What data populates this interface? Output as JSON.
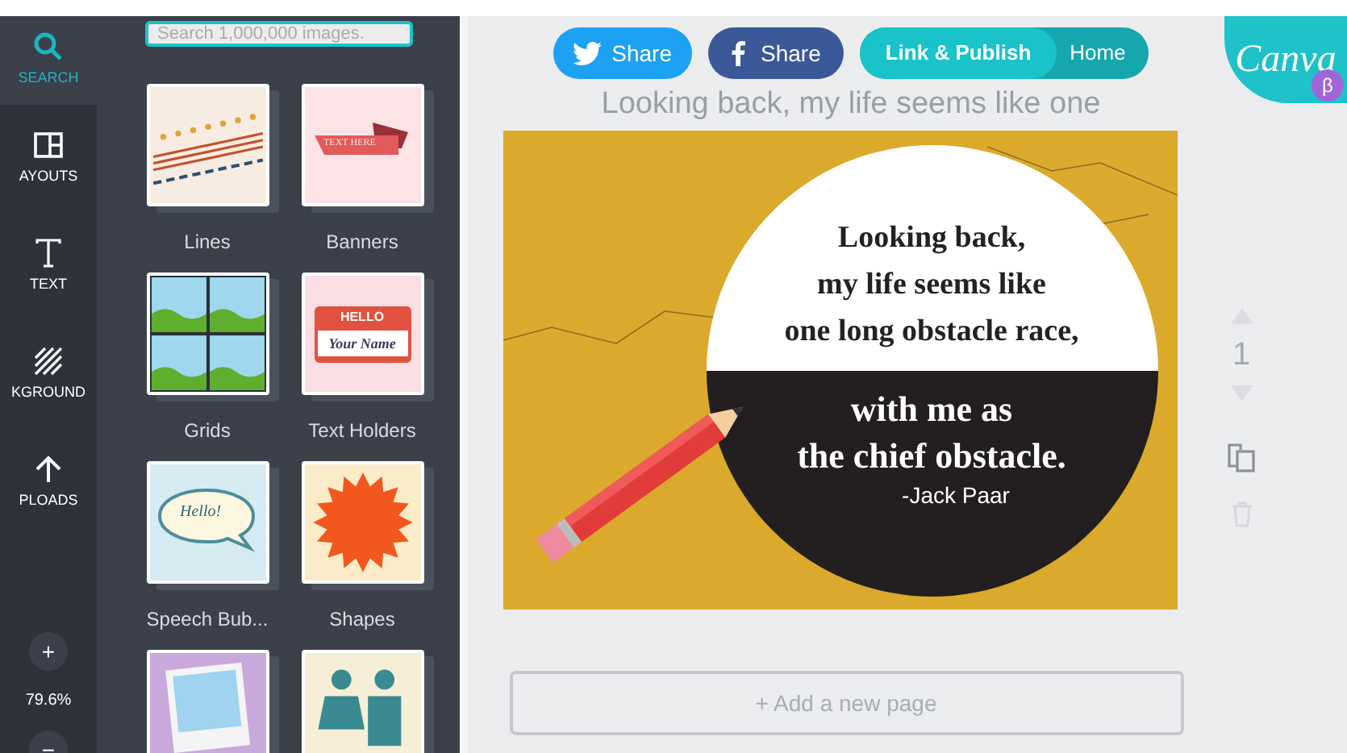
{
  "nav": {
    "items": [
      {
        "label": "SEARCH",
        "kind": "search",
        "selected": true
      },
      {
        "label": "AYOUTS",
        "kind": "layouts",
        "selected": false
      },
      {
        "label": "TEXT",
        "kind": "text",
        "selected": false
      },
      {
        "label": "KGROUND",
        "kind": "background",
        "selected": false
      },
      {
        "label": "PLOADS",
        "kind": "uploads",
        "selected": false
      }
    ],
    "zoom_in": "+",
    "zoom_level": "79.6%",
    "zoom_out": "−"
  },
  "panel": {
    "search": {
      "placeholder": "Search 1,000,000 images."
    },
    "categories": [
      {
        "label": "Lines",
        "kind": "lines"
      },
      {
        "label": "Banners",
        "kind": "banner",
        "banner_text": "TEXT HERE"
      },
      {
        "label": "Grids",
        "kind": "grid"
      },
      {
        "label": "Text Holders",
        "kind": "nametag",
        "tag_title": "HELLO",
        "tag_name": "Your Name"
      },
      {
        "label": "Speech Bub...",
        "kind": "bubble",
        "bubble_text": "Hello!"
      },
      {
        "label": "Shapes",
        "kind": "shape"
      },
      {
        "kind": "frame"
      },
      {
        "kind": "people"
      }
    ]
  },
  "header": {
    "twitter": "Share",
    "facebook": "Share",
    "publish": "Link & Publish",
    "home": "Home",
    "logo": "Canva",
    "beta": "β"
  },
  "design_title": "Looking back, my life seems like one",
  "design": {
    "quote_top": [
      "Looking back,",
      "my life seems like",
      "one long obstacle race,"
    ],
    "quote_bottom": [
      "with me as",
      "the chief obstacle."
    ],
    "author": "-Jack Paar"
  },
  "page_number": "1",
  "add_page": "+ Add a new page"
}
